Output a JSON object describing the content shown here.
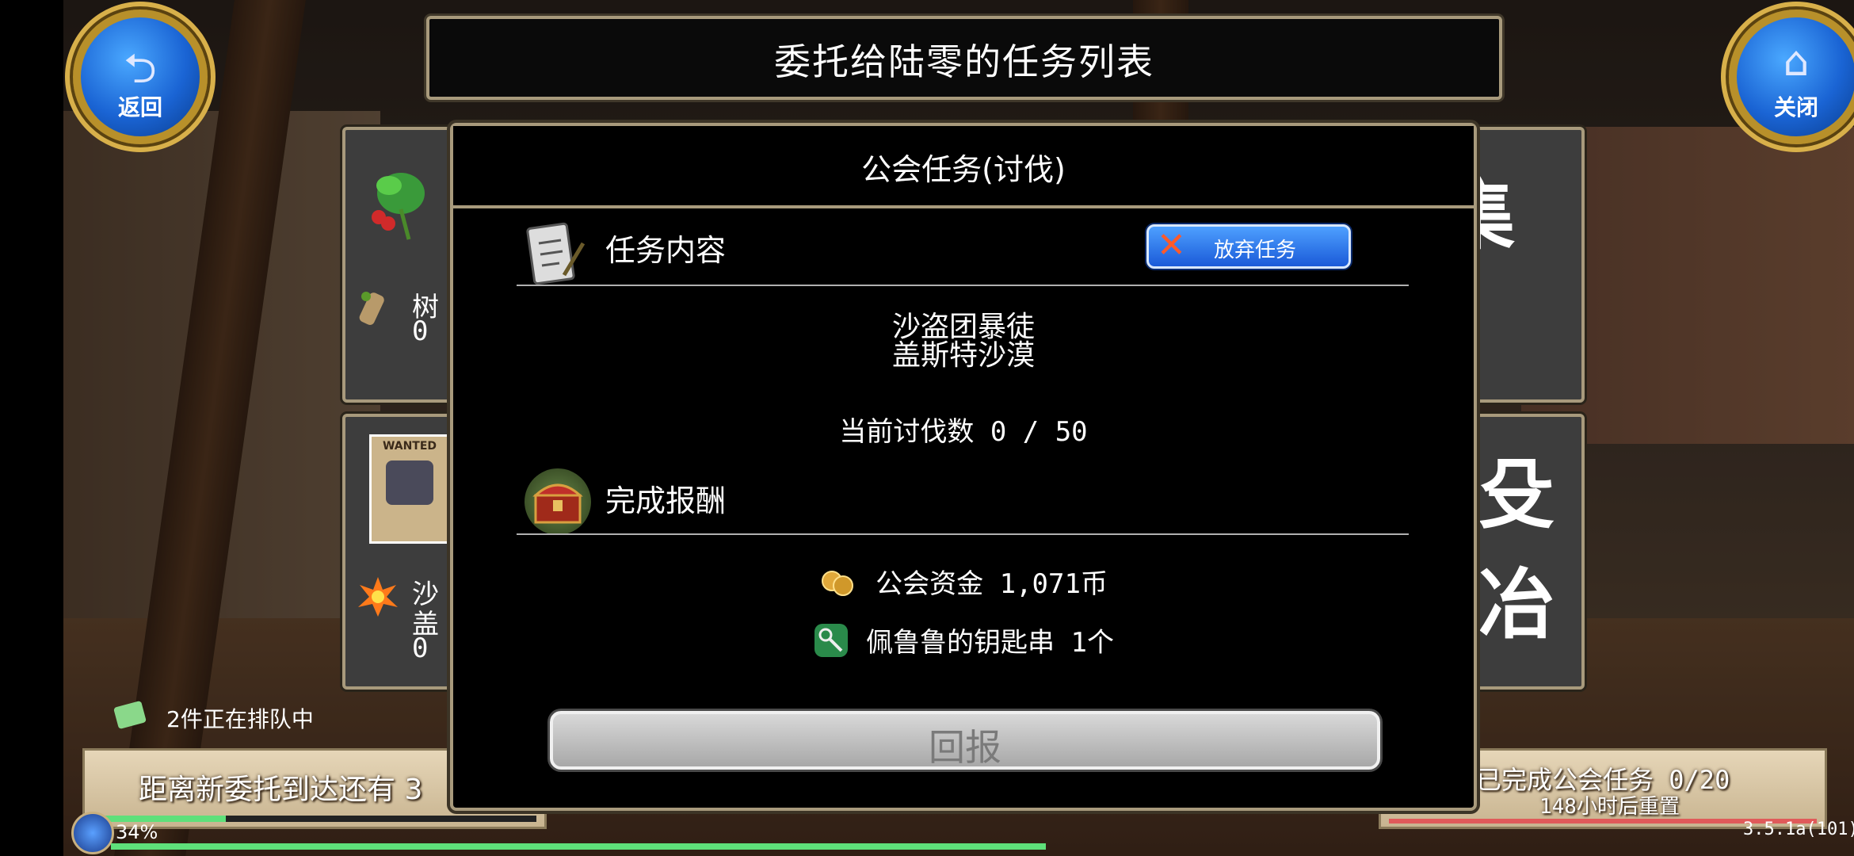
{
  "header": {
    "title": "委托给陆零的任务列表"
  },
  "nav": {
    "back_label": "返回",
    "close_label": "关闭"
  },
  "cards": [
    {
      "text_line1": "树",
      "text_line2": "0 ,",
      "side_label": "集"
    },
    {
      "wanted_label": "WANTED",
      "text_line1": "沙",
      "text_line2": "盖",
      "text_line3": "0 ,",
      "side_label": "殳冶"
    }
  ],
  "modal": {
    "title": "公会任务(讨伐)",
    "content_section": {
      "title": "任务内容",
      "abandon_label": "放弃任务"
    },
    "target": {
      "monster": "沙盗团暴徒",
      "location": "盖斯特沙漠",
      "progress": "当前讨伐数 0 / 50"
    },
    "reward_section": {
      "title": "完成报酬"
    },
    "rewards": [
      {
        "icon": "coins-icon",
        "text": "公会资金 1,071币"
      },
      {
        "icon": "key-ring-icon",
        "text": "佩鲁鲁的钥匙串 1个"
      }
    ],
    "report_label": "回报"
  },
  "queue": {
    "text": "2件正在排队中"
  },
  "bottom_left": {
    "text": "距离新委托到达还有 3",
    "level": "34%"
  },
  "bottom_right": {
    "completed": "已完成公会任务  0/20",
    "reset": "148小时后重置"
  },
  "version": "3.5.1a(101)",
  "colors": {
    "accent_gold": "#a89a7c",
    "button_blue": "#1a5ad8",
    "progress_green": "#5ee07a",
    "progress_red": "#e05a5a"
  }
}
